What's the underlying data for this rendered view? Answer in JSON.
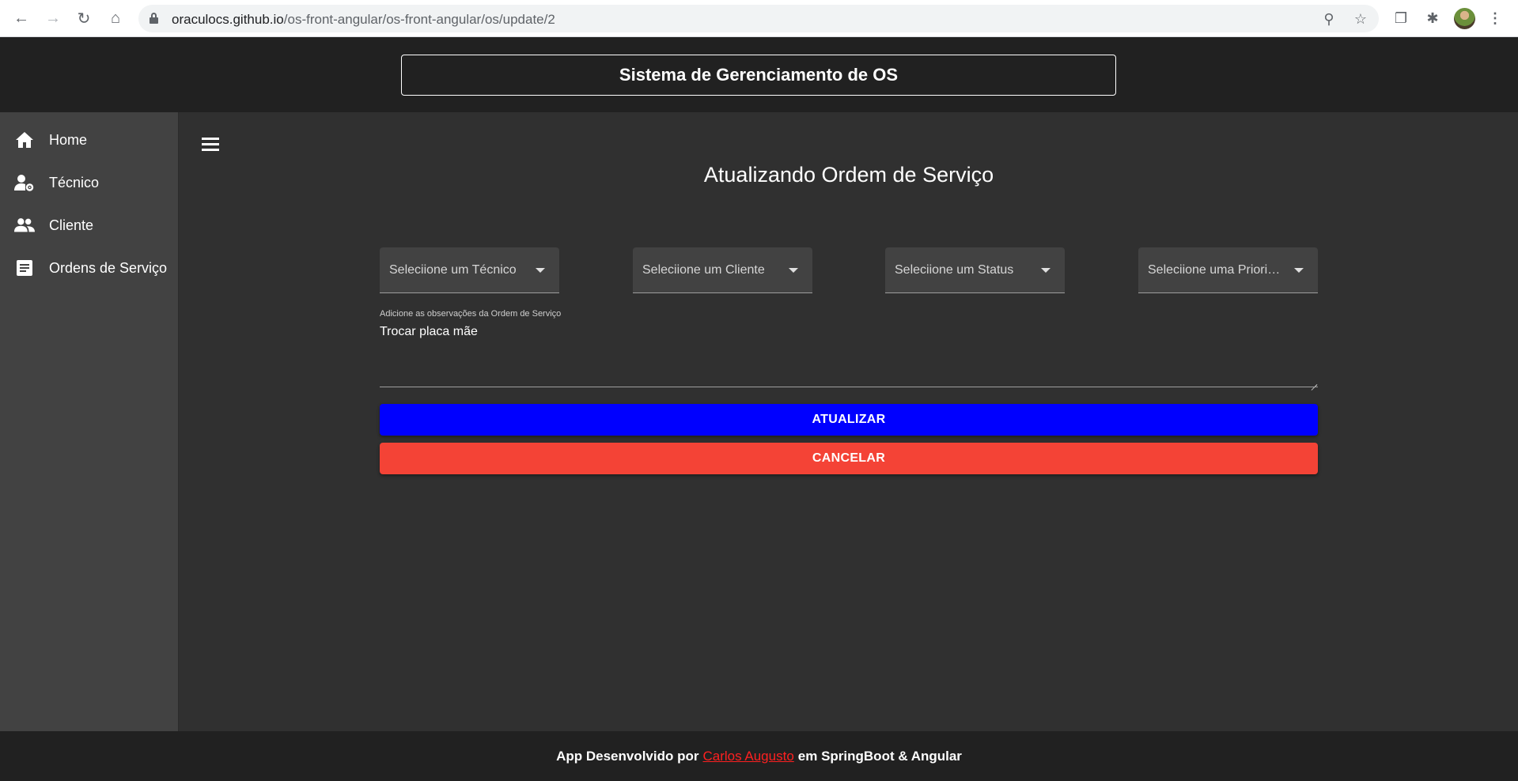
{
  "browser": {
    "url_domain": "oraculocs.github.io",
    "url_path": "/os-front-angular/os-front-angular/os/update/2"
  },
  "header": {
    "title": "Sistema de Gerenciamento de OS"
  },
  "sidebar": {
    "items": [
      {
        "label": "Home",
        "icon": "home-icon"
      },
      {
        "label": "Técnico",
        "icon": "person-gear-icon"
      },
      {
        "label": "Cliente",
        "icon": "people-icon"
      },
      {
        "label": "Ordens de Serviço",
        "icon": "document-icon"
      }
    ]
  },
  "main": {
    "title": "Atualizando Ordem de Serviço",
    "selects": [
      {
        "placeholder": "Seleciione um Técnico"
      },
      {
        "placeholder": "Seleciione um Cliente"
      },
      {
        "placeholder": "Seleciione um Status"
      },
      {
        "placeholder": "Seleciione uma Priorida..."
      }
    ],
    "observations": {
      "label": "Adicione as observações da Ordem de Serviço",
      "value": "Trocar placa mãe"
    },
    "update_label": "ATUALIZAR",
    "cancel_label": "CANCELAR"
  },
  "footer": {
    "prefix": "App Desenvolvido por",
    "author": "Carlos Augusto",
    "suffix": "em SpringBoot & Angular"
  },
  "colors": {
    "update_button": "#0000ff",
    "cancel_button": "#f44336",
    "author_link": "#ff2020"
  }
}
